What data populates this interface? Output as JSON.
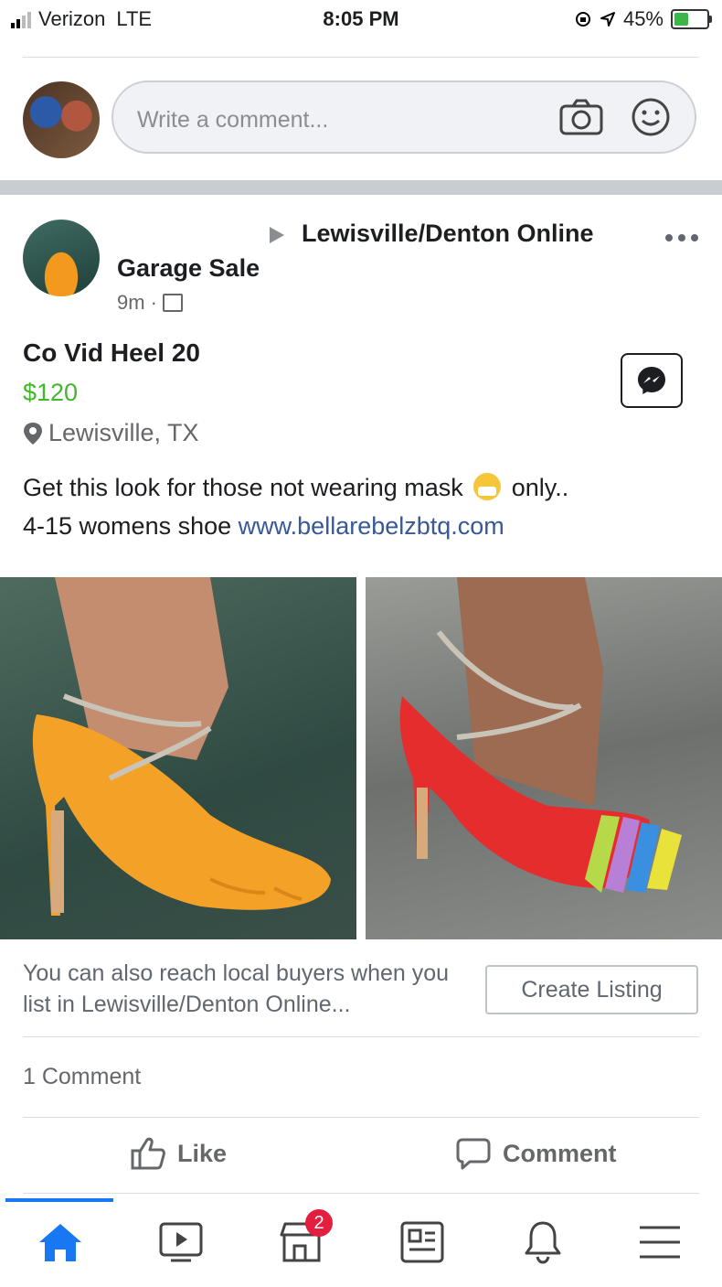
{
  "status_bar": {
    "carrier": "Verizon",
    "network": "LTE",
    "time": "8:05 PM",
    "battery_percent": "45%",
    "battery_level": 0.45,
    "battery_color": "#3cb54a"
  },
  "comment_box": {
    "placeholder": "Write a comment..."
  },
  "post": {
    "group": "Lewisville/Denton Online",
    "author": "Garage Sale",
    "time": "9m",
    "listing_title": "Co Vid Heel 20",
    "price": "$120",
    "location": "Lewisville, TX",
    "text_line1_before": "Get this look for those not wearing mask",
    "text_line1_after": "only..",
    "text_line2_before": "4-15 womens shoe",
    "link": "www.bellarebelzbtq.com",
    "price_color": "#42b72a",
    "link_color": "#385898"
  },
  "promo": {
    "text": "You can also reach local buyers when you list in Lewisville/Denton Online...",
    "button": "Create Listing"
  },
  "comments": {
    "count_label": "1 Comment"
  },
  "actions": {
    "like": "Like",
    "comment": "Comment"
  },
  "tabbar": {
    "active_color": "#1877f2",
    "marketplace_badge": "2",
    "tabs": [
      "home-icon",
      "watch-icon",
      "marketplace-icon",
      "news-icon",
      "bell-icon",
      "menu-icon"
    ]
  }
}
